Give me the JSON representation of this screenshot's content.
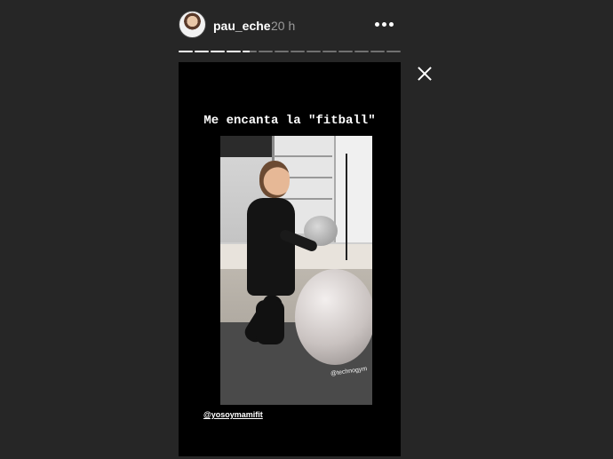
{
  "header": {
    "username": "pau_eche",
    "time": "20 h",
    "more_icon": "more-horizontal-icon"
  },
  "progress": {
    "segments_total": 14,
    "segments_completed": 4,
    "current_segment_fraction": 0.5
  },
  "close_icon": "close-icon",
  "story": {
    "caption": "Me encanta la \"fitball\"",
    "mention": "@yosoymamifit",
    "photo_watermark": "@technogym"
  }
}
